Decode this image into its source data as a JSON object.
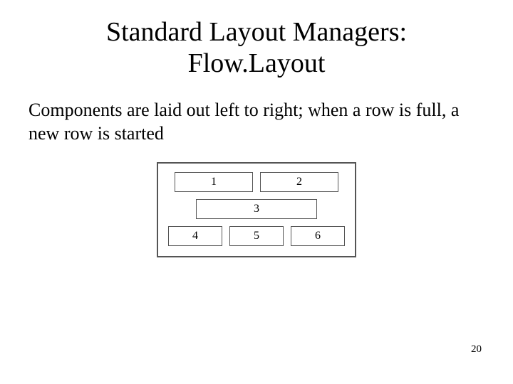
{
  "title_line1": "Standard Layout Managers:",
  "title_line2": "Flow.Layout",
  "body": "Components are laid out left to right; when a row is full, a new row is started",
  "diagram": {
    "row1": [
      "1",
      "2"
    ],
    "row2": [
      "3"
    ],
    "row3": [
      "4",
      "5",
      "6"
    ]
  },
  "page_number": "20"
}
